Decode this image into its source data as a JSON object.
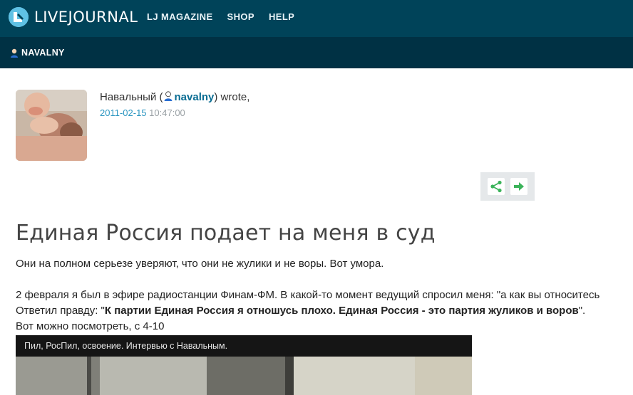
{
  "header": {
    "logo_text": "LIVEJOURNAL",
    "nav": [
      "LJ MAGAZINE",
      "SHOP",
      "HELP"
    ]
  },
  "userbar": {
    "username": "NAVALNY"
  },
  "post": {
    "author_prefix": "Навальный (",
    "author_link": "navalny",
    "author_suffix": ") wrote,",
    "date": "2011-02-15",
    "time": "10:47:00",
    "title": "Единая Россия подает на меня в суд",
    "para1": "Они на полном серьезе уверяют, что они не жулики и не воры. Вот умора.",
    "para2": "2 февраля я был в эфире радиостанции Финам-ФМ. В какой-то момент ведущий спросил меня: \"а как вы относитесь",
    "para3_prefix": "Ответил правду: \"",
    "para3_bold": "К партии Единая Россия я отношусь плохо. Единая Россия - это партия жуликов и воров",
    "para3_suffix": "\".",
    "para4": "Вот можно посмотреть, с 4-10",
    "video_title": "Пил, РосПил, освоение. Интервью с Навальным."
  },
  "colors": {
    "header_bg": "#004359",
    "userbar_bg": "#003144",
    "link": "#0a6d93",
    "date": "#2c96c1",
    "share_green": "#3bb35a"
  },
  "icons": {
    "logo": "livejournal-pencil-logo",
    "user": "user-head-icon",
    "share": "share-icon",
    "forward": "arrow-right-icon"
  }
}
